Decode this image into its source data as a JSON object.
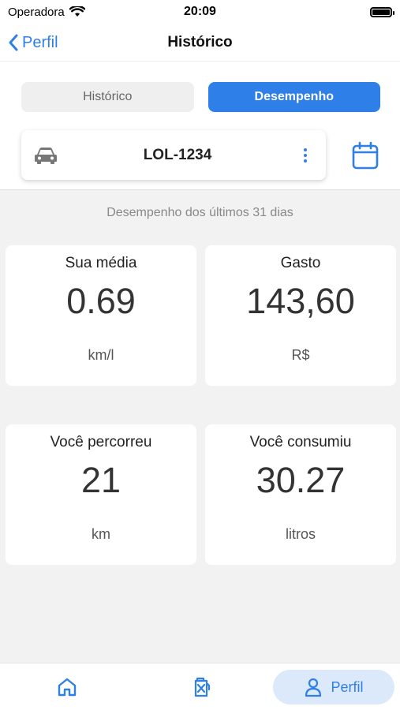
{
  "status_bar": {
    "carrier": "Operadora",
    "time": "20:09"
  },
  "nav": {
    "back_label": "Perfil",
    "title": "Histórico"
  },
  "segment": {
    "tabs": [
      {
        "label": "Histórico",
        "active": false
      },
      {
        "label": "Desempenho",
        "active": true
      }
    ]
  },
  "vehicle": {
    "plate": "LOL-1234"
  },
  "performance": {
    "period_text": "Desempenho dos últimos 31 dias",
    "cards": [
      {
        "label": "Sua média",
        "value": "0.69",
        "unit": "km/l"
      },
      {
        "label": "Gasto",
        "value": "143,60",
        "unit": "R$"
      },
      {
        "label": "Você percorreu",
        "value": "21",
        "unit": "km"
      },
      {
        "label": "Você consumiu",
        "value": "30.27",
        "unit": "litros"
      }
    ]
  },
  "tab_bar": {
    "items": [
      {
        "icon": "home-icon"
      },
      {
        "icon": "fuel-can-icon"
      },
      {
        "icon": "user-icon",
        "label": "Perfil",
        "active": true
      }
    ]
  },
  "colors": {
    "accent": "#2f7fe8",
    "background": "#f2f2f2",
    "inactive_tab": "#efefef",
    "active_tab_pill": "#dbe9fb"
  }
}
